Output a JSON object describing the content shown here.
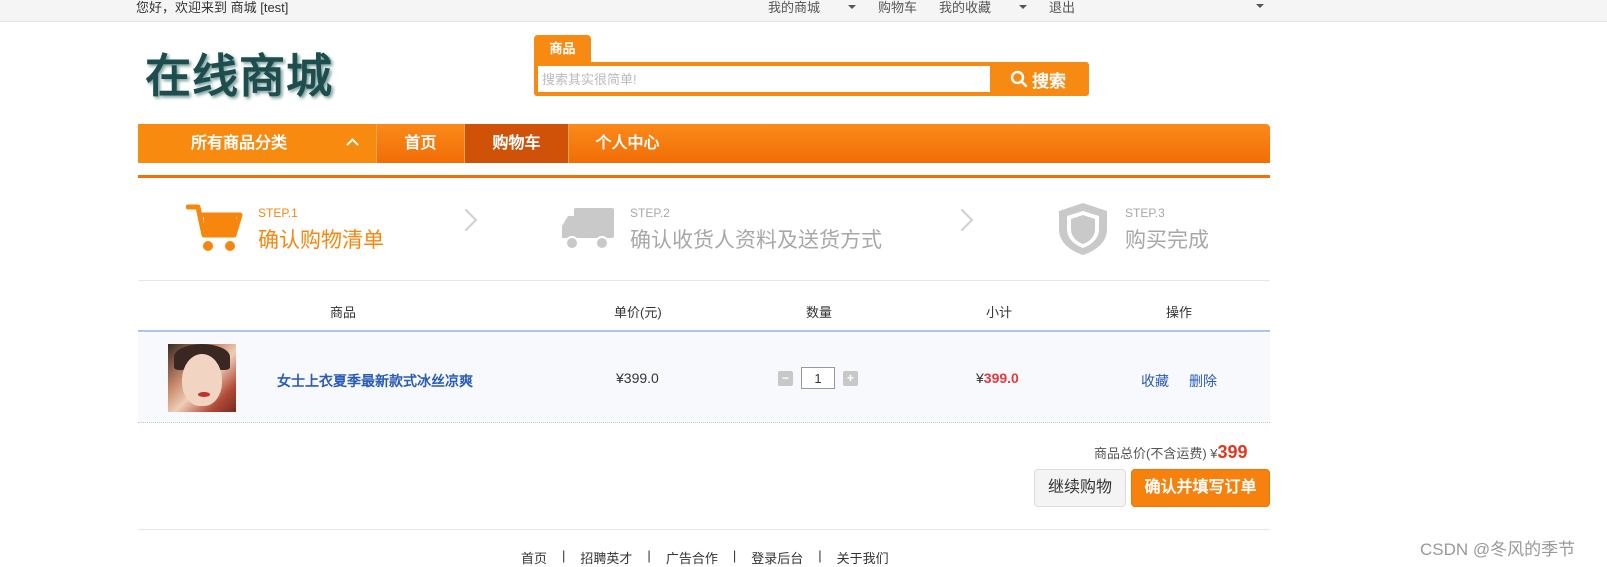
{
  "topbar": {
    "welcome": "您好，欢迎来到 商城 [test]",
    "my_mall": "我的商城",
    "cart": "购物车",
    "favorites": "我的收藏",
    "logout": "退出"
  },
  "header": {
    "logo": "在线商城",
    "search_tab": "商品",
    "search_placeholder": "搜索其实很简单!",
    "search_button": "搜索"
  },
  "nav": {
    "all_categories": "所有商品分类",
    "items": [
      "首页",
      "购物车",
      "个人中心"
    ],
    "active": "购物车"
  },
  "steps": [
    {
      "no": "STEP.1",
      "title": "确认购物清单"
    },
    {
      "no": "STEP.2",
      "title": "确认收货人资料及送货方式"
    },
    {
      "no": "STEP.3",
      "title": "购买完成"
    }
  ],
  "table": {
    "headers": [
      "商品",
      "单价(元)",
      "数量",
      "小计",
      "操作"
    ],
    "rows": [
      {
        "name": "女士上衣夏季最新款式冰丝凉爽",
        "price": "¥399.0",
        "quantity": "1",
        "subtotal_currency": "¥",
        "subtotal": "399.0",
        "actions": [
          "收藏",
          "删除"
        ]
      }
    ]
  },
  "summary": {
    "label": "商品总价(不含运费) ¥",
    "total": "399",
    "continue_button": "继续购物",
    "confirm_button": "确认并填写订单"
  },
  "footer": {
    "links": [
      "首页",
      "招聘英才",
      "广告合作",
      "登录后台",
      "关于我们"
    ],
    "separator": "|"
  },
  "watermark": "CSDN @冬风的季节",
  "colors": {
    "accent": "#f78a12",
    "nav_active": "#cf5208",
    "link": "#2a5bb5",
    "price_red": "#e4393c"
  }
}
